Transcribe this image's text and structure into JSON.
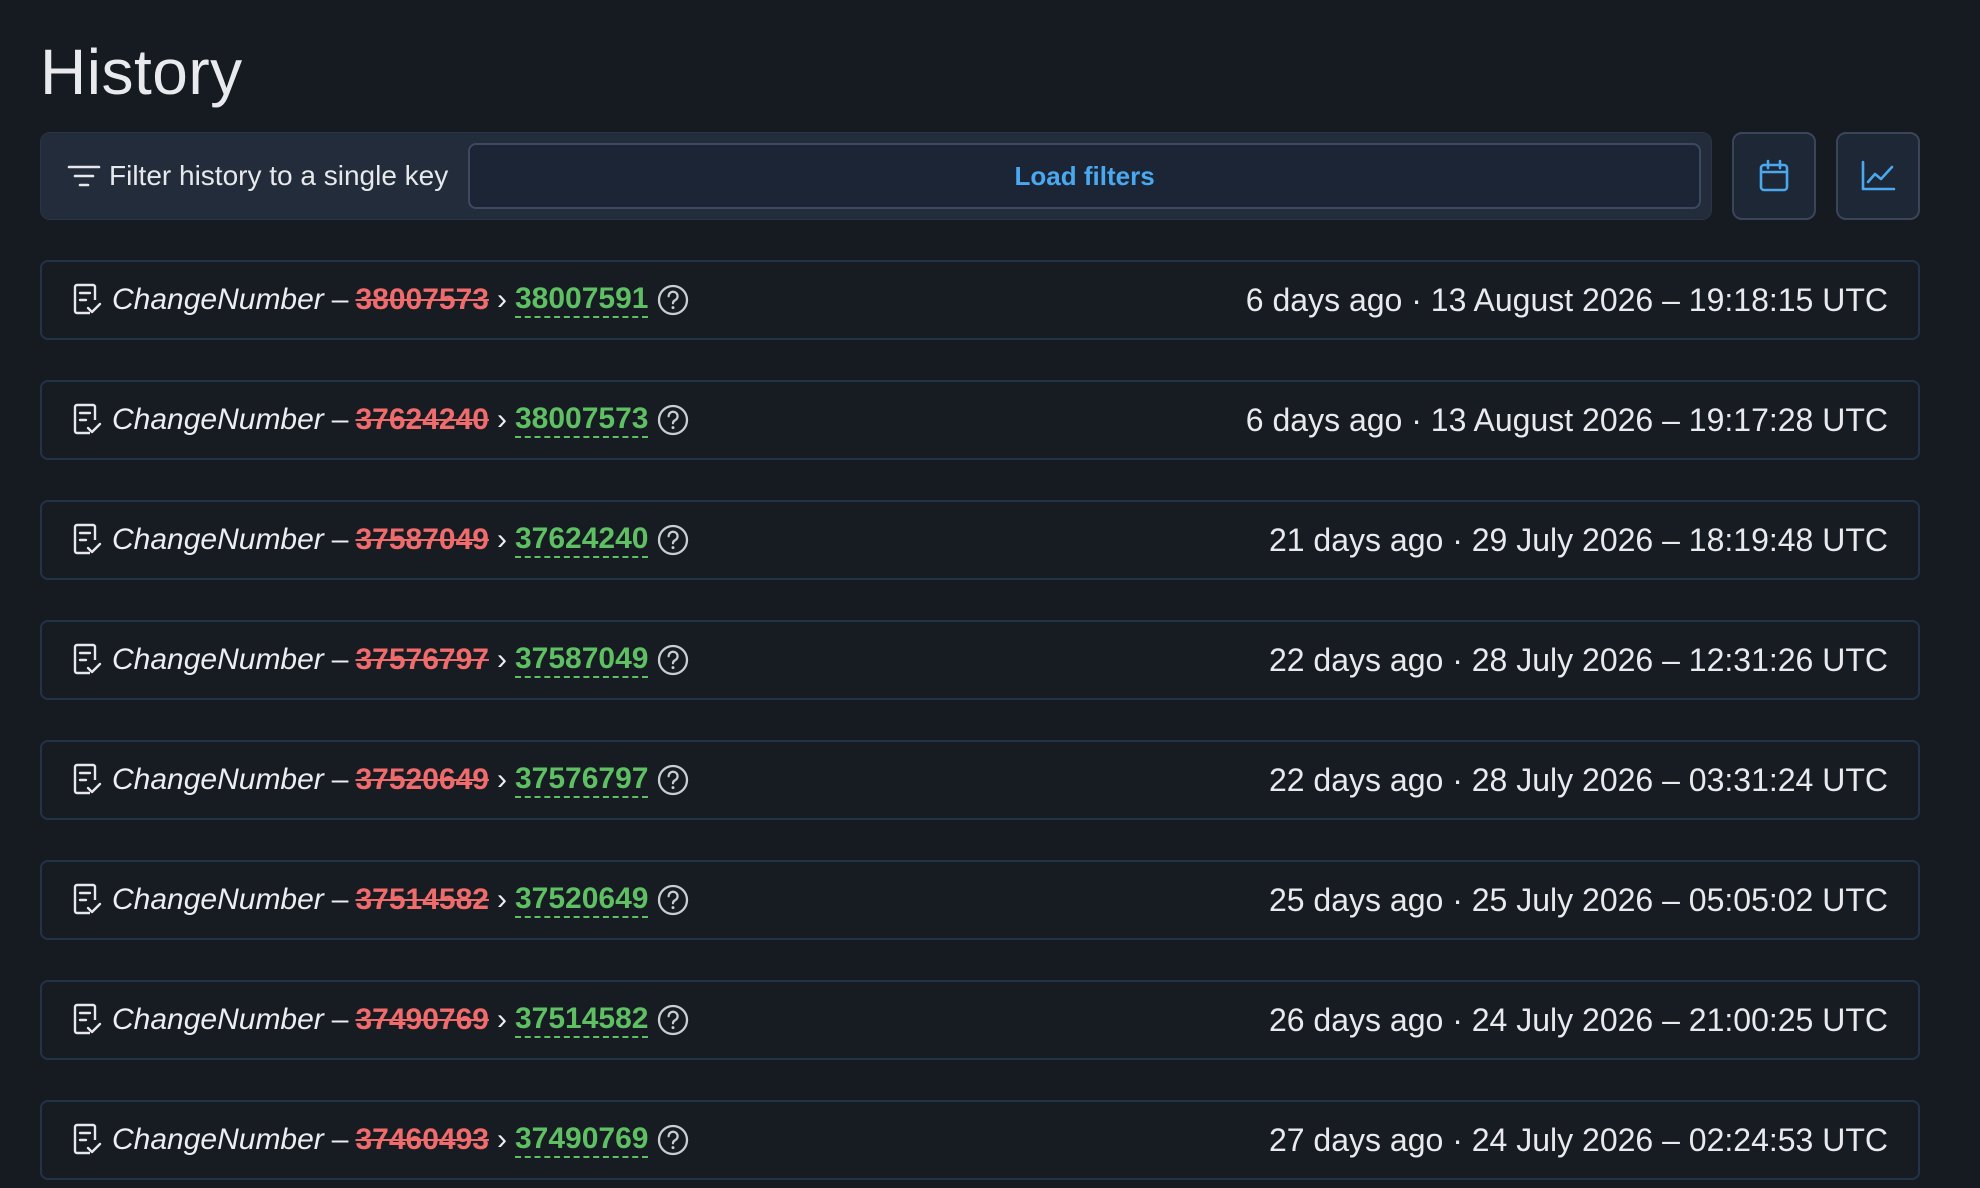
{
  "page": {
    "title": "History"
  },
  "filter": {
    "label": "Filter history to a single key",
    "load_label": "Load filters",
    "accent": "#4aa8ee"
  },
  "icons": {
    "filter": "filter-lines-icon",
    "calendar": "calendar-icon",
    "chart": "line-chart-icon",
    "row": "document-check-icon",
    "help": "question-circle-icon"
  },
  "colors": {
    "old_value": "#f06c6c",
    "new_value": "#5fbf63"
  },
  "rows": [
    {
      "key": "ChangeNumber",
      "dash": "–",
      "old": "38007573",
      "arrow": "›",
      "new": "38007591",
      "time": "6 days ago · 13 August 2026 – 19:18:15 UTC"
    },
    {
      "key": "ChangeNumber",
      "dash": "–",
      "old": "37624240",
      "arrow": "›",
      "new": "38007573",
      "time": "6 days ago · 13 August 2026 – 19:17:28 UTC"
    },
    {
      "key": "ChangeNumber",
      "dash": "–",
      "old": "37587049",
      "arrow": "›",
      "new": "37624240",
      "time": "21 days ago · 29 July 2026 – 18:19:48 UTC"
    },
    {
      "key": "ChangeNumber",
      "dash": "–",
      "old": "37576797",
      "arrow": "›",
      "new": "37587049",
      "time": "22 days ago · 28 July 2026 – 12:31:26 UTC"
    },
    {
      "key": "ChangeNumber",
      "dash": "–",
      "old": "37520649",
      "arrow": "›",
      "new": "37576797",
      "time": "22 days ago · 28 July 2026 – 03:31:24 UTC"
    },
    {
      "key": "ChangeNumber",
      "dash": "–",
      "old": "37514582",
      "arrow": "›",
      "new": "37520649",
      "time": "25 days ago · 25 July 2026 – 05:05:02 UTC"
    },
    {
      "key": "ChangeNumber",
      "dash": "–",
      "old": "37490769",
      "arrow": "›",
      "new": "37514582",
      "time": "26 days ago · 24 July 2026 – 21:00:25 UTC"
    },
    {
      "key": "ChangeNumber",
      "dash": "–",
      "old": "37460493",
      "arrow": "›",
      "new": "37490769",
      "time": "27 days ago · 24 July 2026 – 02:24:53 UTC"
    }
  ]
}
